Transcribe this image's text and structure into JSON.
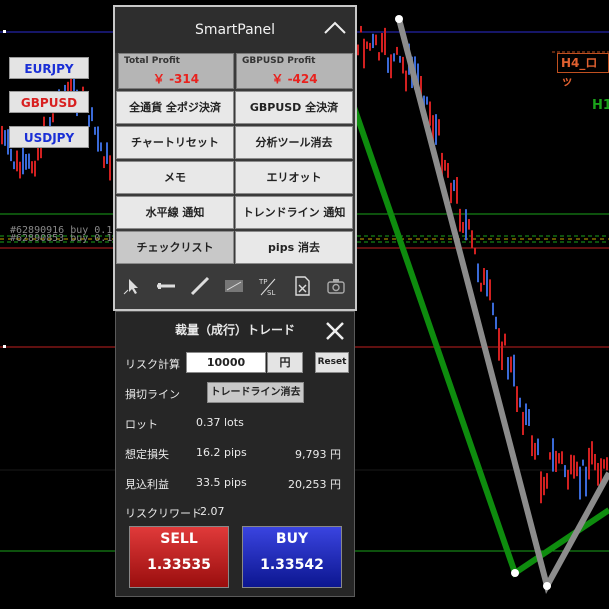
{
  "symbols": [
    {
      "label": "EURJPY",
      "color": "#1a2fd6"
    },
    {
      "label": "GBPUSD",
      "color": "#d82020"
    },
    {
      "label": "USDJPY",
      "color": "#1a2fd6"
    }
  ],
  "chart": {
    "order_line_labels": [
      "#62890916 buy 0.10",
      "#62890853 buy 0.10"
    ],
    "tag_h4": "H4_ロッ",
    "tag_h1": "H1"
  },
  "smart_panel": {
    "title": "SmartPanel",
    "total_profit": {
      "label": "Total Profit",
      "value": "￥ -314"
    },
    "symbol_profit": {
      "label": "GBPUSD Profit",
      "value": "￥ -424"
    },
    "buttons": [
      "全通貨 全ポジ決済",
      "GBPUSD 全決済",
      "チャートリセット",
      "分析ツール消去",
      "メモ",
      "エリオット",
      "水平線 通知",
      "トレンドライン 通知",
      "チェックリスト",
      "pips 消去"
    ],
    "tools": [
      "cursor-tool-icon",
      "hline-tool-icon",
      "trendline-tool-icon",
      "bars-tool-icon",
      "tp-sl-tool-icon",
      "clear-file-icon",
      "screenshot-icon"
    ],
    "tool_text": {
      "tp": "TP",
      "sl": "SL"
    }
  },
  "trade": {
    "title": "裁量（成行）トレード",
    "risk_calc_label": "リスク計算",
    "risk_amount": "10000",
    "risk_unit": "円",
    "reset_label": "Reset",
    "stop_line_label": "損切ライン",
    "trendline_delete_label": "トレードライン消去",
    "lot_label": "ロット",
    "lot_value": "0.37 lots",
    "expected_loss_label": "想定損失",
    "expected_loss_pips": "16.2 pips",
    "expected_loss_yen": "9,793 円",
    "expected_profit_label": "見込利益",
    "expected_profit_pips": "33.5 pips",
    "expected_profit_yen": "20,253 円",
    "rr_label": "リスクリワード",
    "rr_value": "2.07",
    "sell": {
      "label": "SELL",
      "price": "1.33535"
    },
    "buy": {
      "label": "BUY",
      "price": "1.33542"
    }
  },
  "colors": {
    "profit_red": "#e8221e",
    "sell_red": "#c01818",
    "buy_blue": "#1424b8",
    "trend_green": "#0e8c0e",
    "trend_gray": "#8c8c8c"
  }
}
